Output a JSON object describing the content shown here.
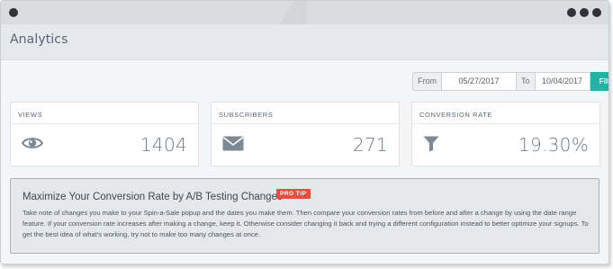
{
  "header": {
    "title": "Analytics"
  },
  "date_range": {
    "from_label": "From",
    "from_value": "05/27/2017",
    "to_label": "To",
    "to_value": "10/04/2017",
    "filter_label": "Filter"
  },
  "stats": [
    {
      "label": "VIEWS",
      "value": "1404",
      "icon": "eye-icon"
    },
    {
      "label": "SUBSCRIBERS",
      "value": "271",
      "icon": "envelope-icon"
    },
    {
      "label": "CONVERSION RATE",
      "value": "19.30%",
      "icon": "funnel-icon"
    }
  ],
  "tip": {
    "title": "Maximize Your Conversion Rate by A/B Testing Changes",
    "badge": "PRO TIP",
    "body": "Take note of changes you make to your Spin-a-Sale popup and the dates you make them. Then compare your conversion rates from before and after a change by using the date range feature. If your conversion rate increases after making a change, keep it. Otherwise consider changing it back and trying a different configuration instead to better optimize your signups. To get the best idea of what's working, try not to make too many changes at once."
  },
  "colors": {
    "accent": "#22b3a4",
    "badge": "#e84d3d",
    "icon": "#7e8a93"
  }
}
